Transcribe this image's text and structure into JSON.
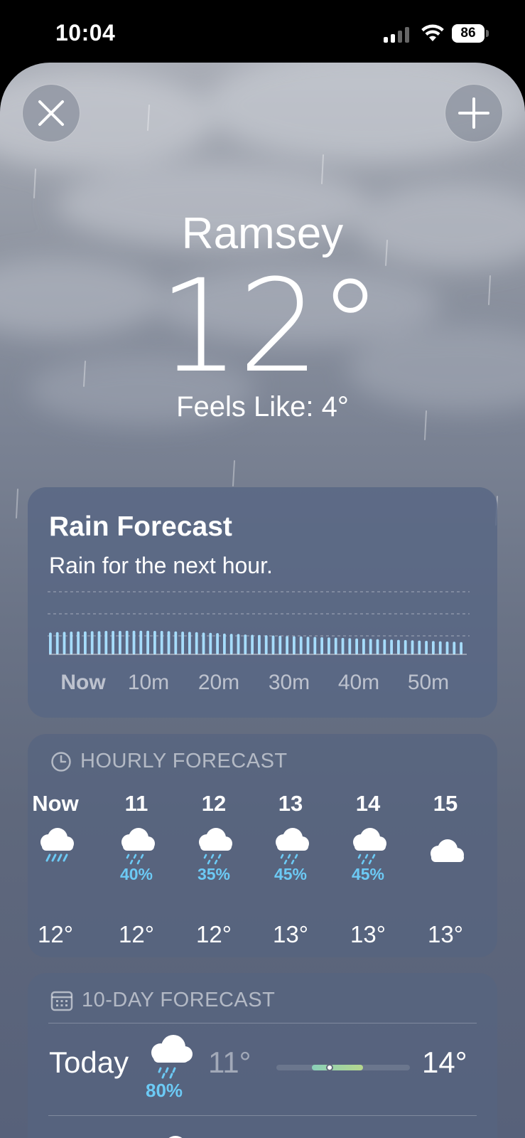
{
  "status": {
    "time": "10:04",
    "battery": "86"
  },
  "header": {
    "close_icon": "close-icon",
    "add_icon": "plus-icon"
  },
  "location": {
    "city": "Ramsey",
    "temperature": "12°",
    "feels_like": "Feels Like: 4°"
  },
  "rain_forecast": {
    "title": "Rain Forecast",
    "summary": "Rain for the next hour.",
    "x_labels": [
      "Now",
      "10m",
      "20m",
      "30m",
      "40m",
      "50m"
    ],
    "chart_data": {
      "type": "bar",
      "intensity": [
        0.9,
        0.92,
        0.93,
        0.94,
        0.95,
        0.95,
        0.96,
        0.96,
        0.97,
        0.97,
        0.97,
        0.98,
        0.98,
        0.98,
        0.98,
        0.97,
        0.97,
        0.96,
        0.95,
        0.94,
        0.93,
        0.92,
        0.9,
        0.89,
        0.88,
        0.86,
        0.85,
        0.84,
        0.82,
        0.81,
        0.8,
        0.79,
        0.78,
        0.77,
        0.76,
        0.75,
        0.74,
        0.73,
        0.72,
        0.71,
        0.7,
        0.69,
        0.68,
        0.67,
        0.66,
        0.65,
        0.64,
        0.63,
        0.62,
        0.61,
        0.6,
        0.59,
        0.58,
        0.57,
        0.56,
        0.55,
        0.54,
        0.53,
        0.52,
        0.51
      ],
      "color": "#a6dcfb"
    }
  },
  "hourly": {
    "heading": "HOURLY FORECAST",
    "hours": [
      {
        "label": "Now",
        "icon": "rain-icon",
        "pct": "",
        "temp": "12°"
      },
      {
        "label": "11",
        "icon": "cloud-drizzle-icon",
        "pct": "40%",
        "temp": "12°"
      },
      {
        "label": "12",
        "icon": "cloud-drizzle-icon",
        "pct": "35%",
        "temp": "12°"
      },
      {
        "label": "13",
        "icon": "cloud-drizzle-icon",
        "pct": "45%",
        "temp": "13°"
      },
      {
        "label": "14",
        "icon": "cloud-drizzle-icon",
        "pct": "45%",
        "temp": "13°"
      },
      {
        "label": "15",
        "icon": "cloud-icon",
        "pct": "",
        "temp": "13°"
      }
    ]
  },
  "ten_day": {
    "heading": "10-DAY FORECAST",
    "days": [
      {
        "name": "Today",
        "icon": "cloud-drizzle-icon",
        "pct": "80%",
        "low": "11°",
        "high": "14°",
        "current_fraction": 0.12,
        "range_start": 0.0,
        "range_end": 0.62
      }
    ]
  },
  "colors": {
    "precip": "#6ccaf5",
    "rain_bar": "#a6dcfb"
  }
}
